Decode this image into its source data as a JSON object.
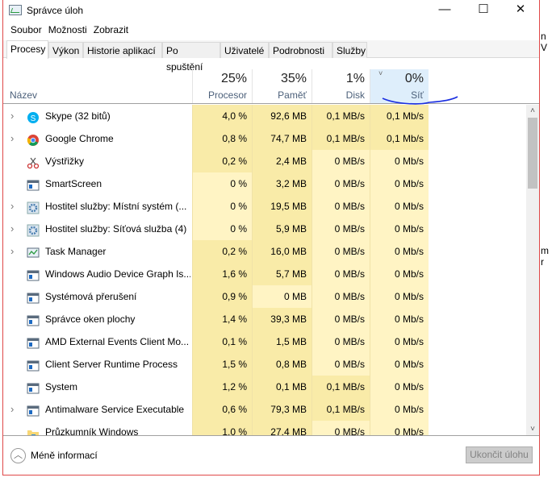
{
  "window": {
    "title": "Správce úloh",
    "minimize": "—",
    "maximize": "☐",
    "close": "✕"
  },
  "background_fragments": [
    "n V",
    "m r"
  ],
  "menu": [
    "Soubor",
    "Možnosti",
    "Zobrazit"
  ],
  "tabs": [
    "Procesy",
    "Výkon",
    "Historie aplikací",
    "Po spuštění",
    "Uživatelé",
    "Podrobnosti",
    "Služby"
  ],
  "active_tab": "Procesy",
  "columns": {
    "name": {
      "label": "Název"
    },
    "cpu": {
      "pct": "25%",
      "label": "Procesor"
    },
    "mem": {
      "pct": "35%",
      "label": "Paměť"
    },
    "disk": {
      "pct": "1%",
      "label": "Disk"
    },
    "net": {
      "pct": "0%",
      "label": "Síť",
      "sorted": true
    }
  },
  "processes": [
    {
      "name": "Skype (32 bitů)",
      "icon": "skype-icon",
      "expand": true,
      "cpu": "4,0 %",
      "mem": "92,6 MB",
      "disk": "0,1 MB/s",
      "net": "0,1 Mb/s"
    },
    {
      "name": "Google Chrome",
      "icon": "chrome-icon",
      "expand": true,
      "cpu": "0,8 %",
      "mem": "74,7 MB",
      "disk": "0,1 MB/s",
      "net": "0,1 Mb/s"
    },
    {
      "name": "Výstřižky",
      "icon": "scissors-icon",
      "expand": false,
      "cpu": "0,2 %",
      "mem": "2,4 MB",
      "disk": "0 MB/s",
      "net": "0 Mb/s"
    },
    {
      "name": "SmartScreen",
      "icon": "window-icon",
      "expand": false,
      "cpu": "0 %",
      "mem": "3,2 MB",
      "disk": "0 MB/s",
      "net": "0 Mb/s"
    },
    {
      "name": "Hostitel služby: Místní systém (...",
      "icon": "gear-icon",
      "expand": true,
      "cpu": "0 %",
      "mem": "19,5 MB",
      "disk": "0 MB/s",
      "net": "0 Mb/s"
    },
    {
      "name": "Hostitel služby: Síťová služba (4)",
      "icon": "gear-icon",
      "expand": true,
      "cpu": "0 %",
      "mem": "5,9 MB",
      "disk": "0 MB/s",
      "net": "0 Mb/s"
    },
    {
      "name": "Task Manager",
      "icon": "taskmanager-icon",
      "expand": true,
      "cpu": "0,2 %",
      "mem": "16,0 MB",
      "disk": "0 MB/s",
      "net": "0 Mb/s"
    },
    {
      "name": "Windows Audio Device Graph Is...",
      "icon": "window-icon",
      "expand": false,
      "cpu": "1,6 %",
      "mem": "5,7 MB",
      "disk": "0 MB/s",
      "net": "0 Mb/s"
    },
    {
      "name": "Systémová přerušení",
      "icon": "window-icon",
      "expand": false,
      "cpu": "0,9 %",
      "mem": "0 MB",
      "disk": "0 MB/s",
      "net": "0 Mb/s"
    },
    {
      "name": "Správce oken plochy",
      "icon": "window-icon",
      "expand": false,
      "cpu": "1,4 %",
      "mem": "39,3 MB",
      "disk": "0 MB/s",
      "net": "0 Mb/s"
    },
    {
      "name": "AMD External Events Client Mo...",
      "icon": "window-icon",
      "expand": false,
      "cpu": "0,1 %",
      "mem": "1,5 MB",
      "disk": "0 MB/s",
      "net": "0 Mb/s"
    },
    {
      "name": "Client Server Runtime Process",
      "icon": "window-icon",
      "expand": false,
      "cpu": "1,5 %",
      "mem": "0,8 MB",
      "disk": "0 MB/s",
      "net": "0 Mb/s"
    },
    {
      "name": "System",
      "icon": "window-icon",
      "expand": false,
      "cpu": "1,2 %",
      "mem": "0,1 MB",
      "disk": "0,1 MB/s",
      "net": "0 Mb/s"
    },
    {
      "name": "Antimalware Service Executable",
      "icon": "window-icon",
      "expand": true,
      "cpu": "0,6 %",
      "mem": "79,3 MB",
      "disk": "0,1 MB/s",
      "net": "0 Mb/s"
    },
    {
      "name": "Průzkumník Windows",
      "icon": "folder-icon",
      "expand": false,
      "cpu": "1,0 %",
      "mem": "27,4 MB",
      "disk": "0 MB/s",
      "net": "0 Mb/s"
    }
  ],
  "footer": {
    "less_info": "Méně informací",
    "end_task": "Ukončit úlohu"
  }
}
